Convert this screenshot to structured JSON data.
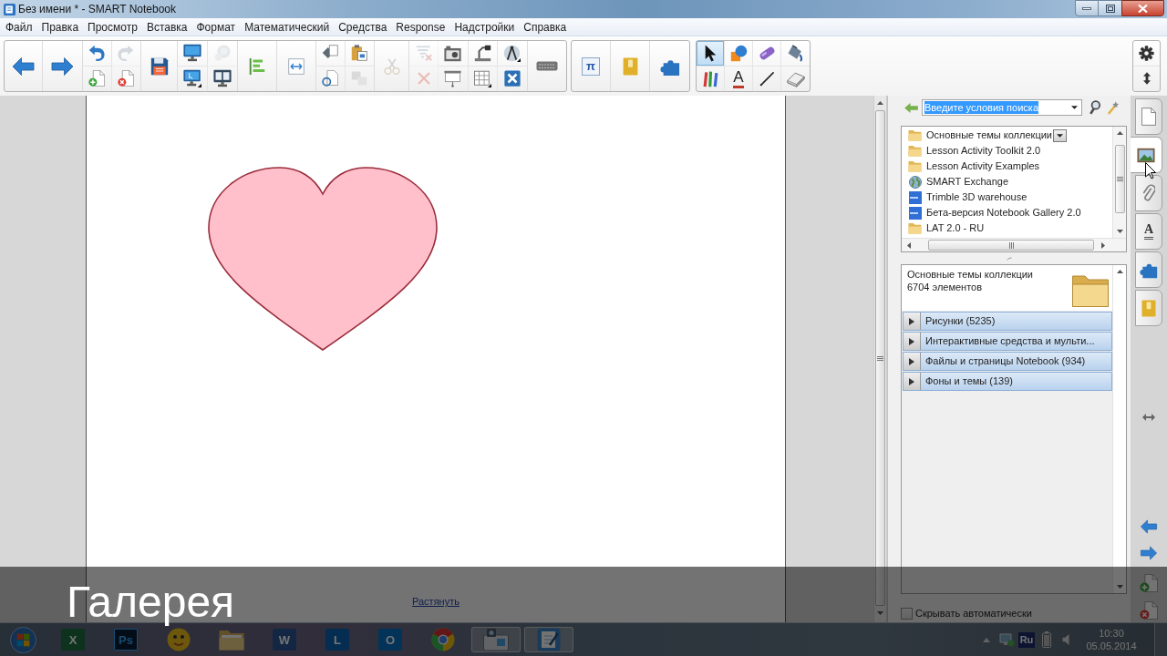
{
  "window": {
    "title": "Без имени * - SMART Notebook"
  },
  "menu": [
    "Файл",
    "Правка",
    "Просмотр",
    "Вставка",
    "Формат",
    "Математический",
    "Средства",
    "Response",
    "Надстройки",
    "Справка"
  ],
  "toolbar": {
    "main": [
      {
        "disabled": false
      },
      {
        "disabled": false
      },
      {
        "disabled": false
      },
      {
        "disabled": true
      },
      {
        "disabled": false
      },
      {
        "disabled": false
      },
      {
        "disabled": false
      },
      {
        "disabled": false
      },
      {
        "disabled": true
      },
      {
        "disabled": false
      },
      {
        "disabled": false
      },
      {
        "disabled": false
      },
      {
        "disabled": false
      },
      {
        "disabled": false
      },
      {
        "disabled": false
      },
      {
        "disabled": false
      },
      {
        "disabled": true
      },
      {
        "disabled": true
      },
      {
        "disabled": true
      },
      {
        "disabled": false
      },
      {
        "disabled": false
      },
      {
        "disabled": false
      },
      {
        "disabled": true
      },
      {
        "disabled": false
      },
      {
        "disabled": false
      },
      {
        "disabled": false
      },
      {
        "disabled": false
      }
    ],
    "addons": [
      {
        "glyph": "π",
        "disabled": false
      },
      {
        "disabled": false
      },
      {
        "disabled": false
      }
    ],
    "tools": [
      {
        "selected": true
      },
      {
        "selected": false
      },
      {
        "selected": false
      },
      {
        "selected": false
      },
      {
        "selected": false
      },
      {
        "glyph": "A",
        "selected": false
      },
      {
        "selected": false
      },
      {
        "selected": false
      }
    ],
    "settings": [
      {
        "disabled": false
      },
      {
        "disabled": false
      }
    ]
  },
  "page": {
    "objects": [
      {
        "kind": "heart"
      }
    ],
    "stretch_link": "Растянуть"
  },
  "gallery": {
    "search": {
      "value": "Введите условия поиска",
      "text_selected": true
    },
    "collections": [
      {
        "label": "Основные темы коллекции",
        "kind": "folder",
        "selected": true
      },
      {
        "label": "Lesson Activity Toolkit 2.0",
        "kind": "folder",
        "selected": false
      },
      {
        "label": "Lesson Activity Examples",
        "kind": "folder",
        "selected": false
      },
      {
        "label": "SMART Exchange",
        "kind": "globe",
        "selected": false
      },
      {
        "label": "Trimble 3D warehouse",
        "kind": "web",
        "selected": false
      },
      {
        "label": "Бета-версия Notebook Gallery 2.0",
        "kind": "web",
        "selected": false
      },
      {
        "label": "LAT 2.0 - RU",
        "kind": "folder",
        "selected": false
      }
    ],
    "details": {
      "title": "Основные темы коллекции",
      "count": "6704 элементов",
      "categories": [
        {
          "label": "Рисунки (5235)",
          "expanded": false
        },
        {
          "label": "Интерактивные средства и мульти...",
          "expanded": false
        },
        {
          "label": "Файлы и страницы Notebook (934)",
          "expanded": false
        },
        {
          "label": "Фоны и темы (139)",
          "expanded": false
        }
      ]
    },
    "auto_hide": {
      "label": "Скрывать автоматически",
      "checked": false
    }
  },
  "side_tabs": [
    {
      "selected": false
    },
    {
      "selected": true
    },
    {
      "selected": false
    },
    {
      "glyph": "A",
      "selected": false
    },
    {
      "selected": false
    },
    {
      "selected": false
    }
  ],
  "caption": "Галерея",
  "taskbar": {
    "apps": [
      {
        "glyph": "X",
        "running": false
      },
      {
        "glyph": "Ps",
        "running": false
      },
      {
        "running": false
      },
      {
        "running": false
      },
      {
        "glyph": "W",
        "running": false
      },
      {
        "glyph": "L",
        "running": false
      },
      {
        "glyph": "O",
        "running": false
      },
      {
        "running": false
      },
      {
        "running": true
      },
      {
        "running": true
      }
    ],
    "tray": {
      "language": "Ru",
      "time": "10:30",
      "date": "05.05.2014"
    }
  }
}
